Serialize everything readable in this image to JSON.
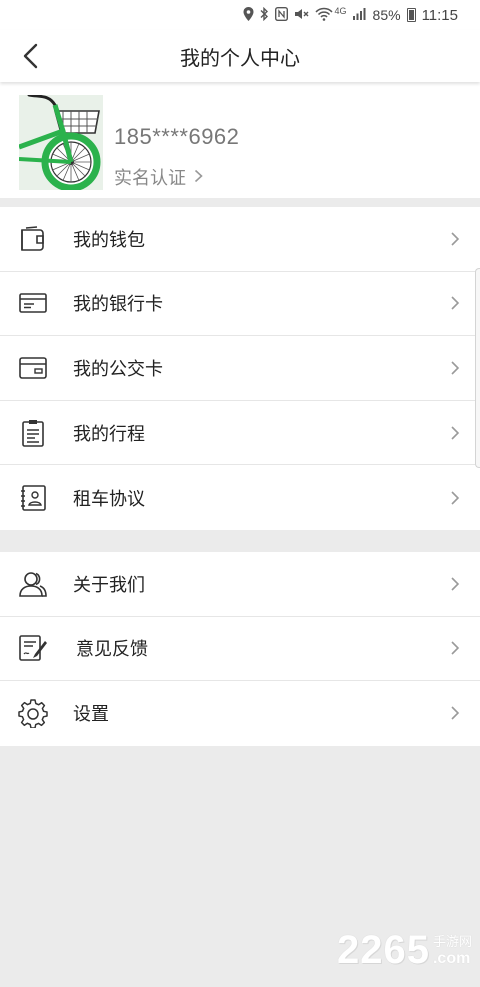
{
  "status_bar": {
    "battery": "85%",
    "time": "11:15",
    "network": "4G"
  },
  "header": {
    "title": "我的个人中心"
  },
  "profile": {
    "phone": "185****6962",
    "verify_label": "实名认证"
  },
  "menu_group_1": [
    {
      "label": "我的钱包",
      "icon": "wallet-icon"
    },
    {
      "label": "我的银行卡",
      "icon": "bank-card-icon"
    },
    {
      "label": "我的公交卡",
      "icon": "bus-card-icon"
    },
    {
      "label": "我的行程",
      "icon": "trip-clipboard-icon"
    },
    {
      "label": "租车协议",
      "icon": "contract-icon"
    }
  ],
  "menu_group_2": [
    {
      "label": "关于我们",
      "icon": "users-icon"
    },
    {
      "label": "意见反馈",
      "icon": "feedback-icon"
    },
    {
      "label": "设置",
      "icon": "gear-icon"
    }
  ],
  "watermark": {
    "number": "2265",
    "site_cn": "手游网",
    "site_domain": ".com"
  },
  "colors": {
    "bike_green": "#2bb24c",
    "background": "#ebebeb"
  }
}
